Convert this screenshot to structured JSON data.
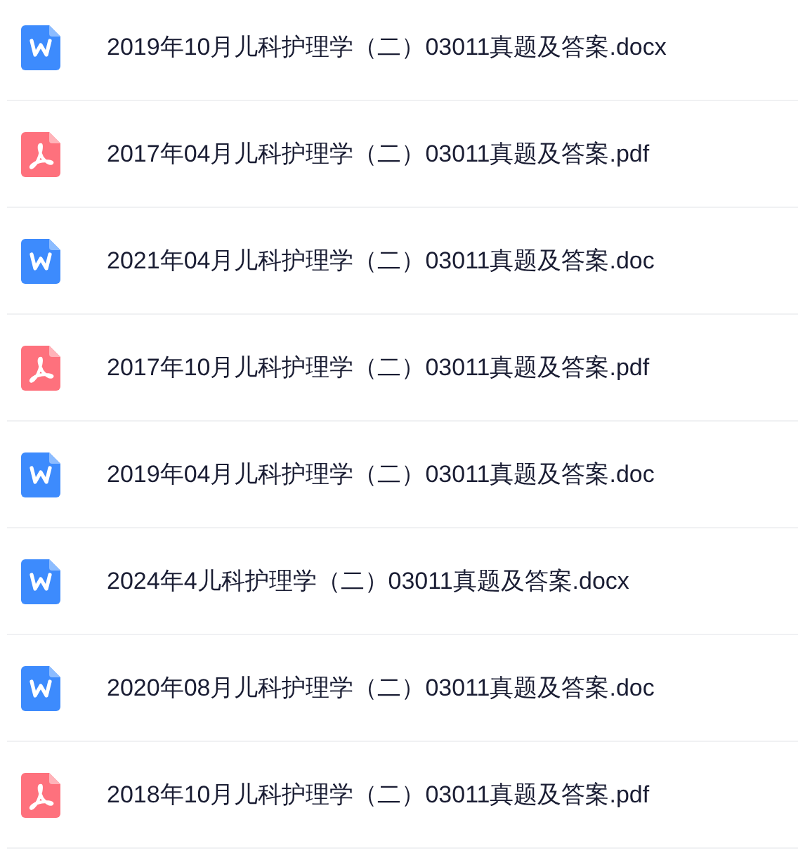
{
  "files": [
    {
      "kind": "word",
      "name": "2019年10月儿科护理学（二）03011真题及答案.docx"
    },
    {
      "kind": "pdf",
      "name": "2017年04月儿科护理学（二）03011真题及答案.pdf"
    },
    {
      "kind": "word",
      "name": "2021年04月儿科护理学（二）03011真题及答案.doc"
    },
    {
      "kind": "pdf",
      "name": "2017年10月儿科护理学（二）03011真题及答案.pdf"
    },
    {
      "kind": "word",
      "name": "2019年04月儿科护理学（二）03011真题及答案.doc"
    },
    {
      "kind": "word",
      "name": "2024年4儿科护理学（二）03011真题及答案.docx"
    },
    {
      "kind": "word",
      "name": "2020年08月儿科护理学（二）03011真题及答案.doc"
    },
    {
      "kind": "pdf",
      "name": "2018年10月儿科护理学（二）03011真题及答案.pdf"
    }
  ]
}
